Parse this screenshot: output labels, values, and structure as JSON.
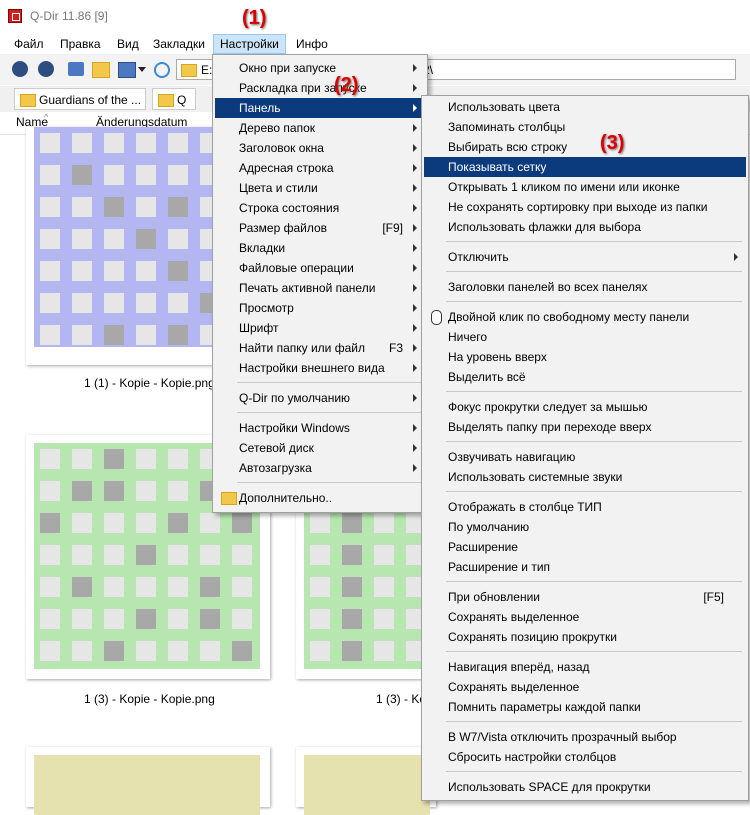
{
  "window": {
    "title": "Q-Dir 11.86 [9]"
  },
  "menubar": [
    "Файл",
    "Правка",
    "Вид",
    "Закладки",
    "Настройки",
    "Инфо"
  ],
  "address": {
    "left_value": "E:\\",
    "right_value": "2\\"
  },
  "tabs": [
    "Guardians of the ...",
    "Q"
  ],
  "columns": {
    "name": "Name",
    "date": "Änderungsdatum"
  },
  "files": [
    "1 (1) - Kopie - Kopie.png",
    "1 (3) - Kopie - Kopie.png",
    "1 (3) - Ko"
  ],
  "annotations": [
    "(1)",
    "(2)",
    "(3)"
  ],
  "settings_menu": [
    {
      "label": "Окно при запуске",
      "arrow": true
    },
    {
      "label": "Раскладка при запуске",
      "arrow": true
    },
    {
      "label": "Панель",
      "arrow": true,
      "highlight": true
    },
    {
      "label": "Дерево папок",
      "arrow": true
    },
    {
      "label": "Заголовок окна",
      "arrow": true
    },
    {
      "label": "Адресная строка",
      "arrow": true
    },
    {
      "label": "Цвета и стили",
      "arrow": true
    },
    {
      "label": "Строка состояния",
      "arrow": true
    },
    {
      "label": "Размер файлов",
      "shortcut": "[F9]",
      "arrow": true
    },
    {
      "label": "Вкладки",
      "arrow": true
    },
    {
      "label": "Файловые операции",
      "arrow": true
    },
    {
      "label": "Печать активной панели",
      "arrow": true
    },
    {
      "label": "Просмотр",
      "arrow": true
    },
    {
      "label": "Шрифт",
      "arrow": true
    },
    {
      "label": "Найти папку или файл",
      "shortcut": "F3",
      "arrow": true
    },
    {
      "label": "Настройки внешнего вида",
      "arrow": true
    },
    {
      "sep": true
    },
    {
      "label": "Q-Dir по умолчанию",
      "arrow": true
    },
    {
      "sep": true
    },
    {
      "label": "Настройки Windows",
      "arrow": true
    },
    {
      "label": "Сетевой диск",
      "arrow": true
    },
    {
      "label": "Автозагрузка",
      "arrow": true
    },
    {
      "sep": true
    },
    {
      "label": "Дополнительно..",
      "icon": "folder"
    }
  ],
  "panel_menu": [
    {
      "label": "Использовать цвета"
    },
    {
      "label": "Запоминать столбцы"
    },
    {
      "label": "Выбирать всю строку"
    },
    {
      "label": "Показывать сетку",
      "highlight": true
    },
    {
      "label": "Открывать 1 кликом по имени или иконке"
    },
    {
      "label": "Не сохранять сортировку при выходе из папки"
    },
    {
      "label": "Использовать флажки для выбора"
    },
    {
      "sep": true
    },
    {
      "label": "Отключить",
      "arrow": true
    },
    {
      "sep": true
    },
    {
      "label": "Заголовки панелей во всех панелях"
    },
    {
      "sep": true
    },
    {
      "label": "Двойной клик по свободному месту панели",
      "icon": "mouse"
    },
    {
      "label": "Ничего"
    },
    {
      "label": "На уровень вверх"
    },
    {
      "label": "Выделить всё"
    },
    {
      "sep": true
    },
    {
      "label": "Фокус прокрутки следует за мышью"
    },
    {
      "label": "Выделять папку при переходе вверх"
    },
    {
      "sep": true
    },
    {
      "label": "Озвучивать навигацию"
    },
    {
      "label": "Использовать системные звуки"
    },
    {
      "sep": true
    },
    {
      "label": "Отображать в столбце ТИП"
    },
    {
      "label": "По умолчанию"
    },
    {
      "label": "Расширение"
    },
    {
      "label": "Расширение и тип"
    },
    {
      "sep": true
    },
    {
      "label": "При обновлении",
      "shortcut": "[F5]"
    },
    {
      "label": "Сохранять выделенное"
    },
    {
      "label": "Сохранять позицию прокрутки"
    },
    {
      "sep": true
    },
    {
      "label": "Навигация вперёд, назад"
    },
    {
      "label": "Сохранять выделенное"
    },
    {
      "label": "Помнить параметры каждой папки"
    },
    {
      "sep": true
    },
    {
      "label": "В W7/Vista отключить прозрачный выбор"
    },
    {
      "label": "Сбросить настройки столбцов"
    },
    {
      "sep": true
    },
    {
      "label": "Использовать SPACE для прокрутки"
    }
  ],
  "colors": {
    "highlight": "#0c3b7d",
    "annotation": "#e00000",
    "blue_grid": "#b3b6f0",
    "green_grid": "#b8e6b0",
    "yellow_grid": "#e6e2b0"
  }
}
